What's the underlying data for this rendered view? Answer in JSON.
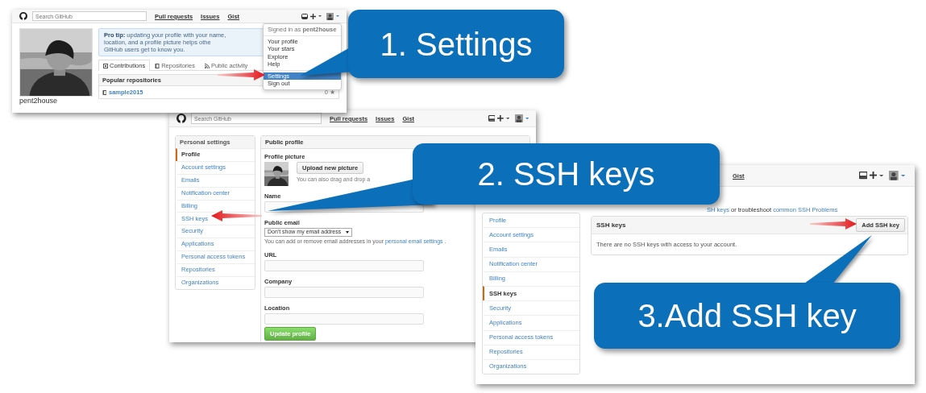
{
  "profile_page": {
    "header": {
      "search_placeholder": "Search GitHub",
      "nav": [
        "Pull requests",
        "Issues",
        "Gist"
      ]
    },
    "avatar_caption": "pent2house",
    "pro_tip_lines": [
      "**Pro tip:** updating your profile with your name, location, and a profile picture helps othe",
      "GitHub users get to know you."
    ],
    "tabs": [
      {
        "label": "Contributions",
        "selected": true
      },
      {
        "label": "Repositories",
        "selected": false
      },
      {
        "label": "Public activity",
        "selected": false
      }
    ],
    "popular": {
      "title": "Popular repositories",
      "repos": [
        {
          "name": "sample2015",
          "star_count": "0 ★"
        }
      ]
    },
    "menu": {
      "signed_in": "Signed in as **pent2house**",
      "groups": [
        [
          {
            "label": "Your profile",
            "selected": false
          },
          {
            "label": "Your stars",
            "selected": false
          },
          {
            "label": "Explore",
            "selected": false
          },
          {
            "label": "Help",
            "selected": false
          }
        ],
        [
          {
            "label": "Settings",
            "selected": true
          },
          {
            "label": "Sign out",
            "selected": false
          }
        ]
      ]
    }
  },
  "settings_page": {
    "header": {
      "search_placeholder": "Search GitHub",
      "nav": [
        "Pull requests",
        "Issues",
        "Gist"
      ]
    },
    "sidebar": {
      "title": "Personal settings",
      "items": [
        {
          "label": "Profile",
          "selected": true
        },
        {
          "label": "Account settings",
          "selected": false
        },
        {
          "label": "Emails",
          "selected": false
        },
        {
          "label": "Notification center",
          "selected": false
        },
        {
          "label": "Billing",
          "selected": false
        },
        {
          "label": "SSH keys",
          "selected": false
        },
        {
          "label": "Security",
          "selected": false
        },
        {
          "label": "Applications",
          "selected": false
        },
        {
          "label": "Personal access tokens",
          "selected": false
        },
        {
          "label": "Repositories",
          "selected": false
        },
        {
          "label": "Organizations",
          "selected": false
        }
      ]
    },
    "panel_title": "Public profile",
    "picture_label": "Profile picture",
    "upload_button": "Upload new picture",
    "upload_hint": "You can also drag and drop a",
    "fields": [
      {
        "label": "Name",
        "kind": "text"
      },
      {
        "label": "Public email",
        "kind": "select",
        "value": "Don't show my email address",
        "help": [
          {
            "text": "You can add or remove email addresses in your "
          },
          {
            "text": "personal email settings",
            "link": true
          },
          {
            "text": " ."
          }
        ]
      },
      {
        "label": "URL",
        "kind": "text"
      },
      {
        "label": "Company",
        "kind": "text"
      },
      {
        "label": "Location",
        "kind": "text"
      }
    ],
    "submit_button": "Update profile"
  },
  "ssh_page": {
    "header": {
      "nav": [
        "Gist"
      ]
    },
    "intro": [
      {
        "text": "SH keys",
        "link": true
      },
      {
        "text": " or troubleshoot "
      },
      {
        "text": "common SSH Problems",
        "link": true
      }
    ],
    "sidebar": {
      "items": [
        {
          "label": "Profile",
          "selected": false
        },
        {
          "label": "Account settings",
          "selected": false
        },
        {
          "label": "Emails",
          "selected": false
        },
        {
          "label": "Notification center",
          "selected": false
        },
        {
          "label": "Billing",
          "selected": false
        },
        {
          "label": "SSH keys",
          "selected": true
        },
        {
          "label": "Security",
          "selected": false
        },
        {
          "label": "Applications",
          "selected": false
        },
        {
          "label": "Personal access tokens",
          "selected": false
        },
        {
          "label": "Repositories",
          "selected": false
        },
        {
          "label": "Organizations",
          "selected": false
        }
      ]
    },
    "panel": {
      "title": "SSH keys",
      "button": "Add SSH key",
      "empty_text": "There are no SSH keys with access to your account."
    }
  },
  "callouts": [
    {
      "text": "1. Settings"
    },
    {
      "text": "2. SSH keys"
    },
    {
      "text": "3.Add SSH key"
    }
  ]
}
